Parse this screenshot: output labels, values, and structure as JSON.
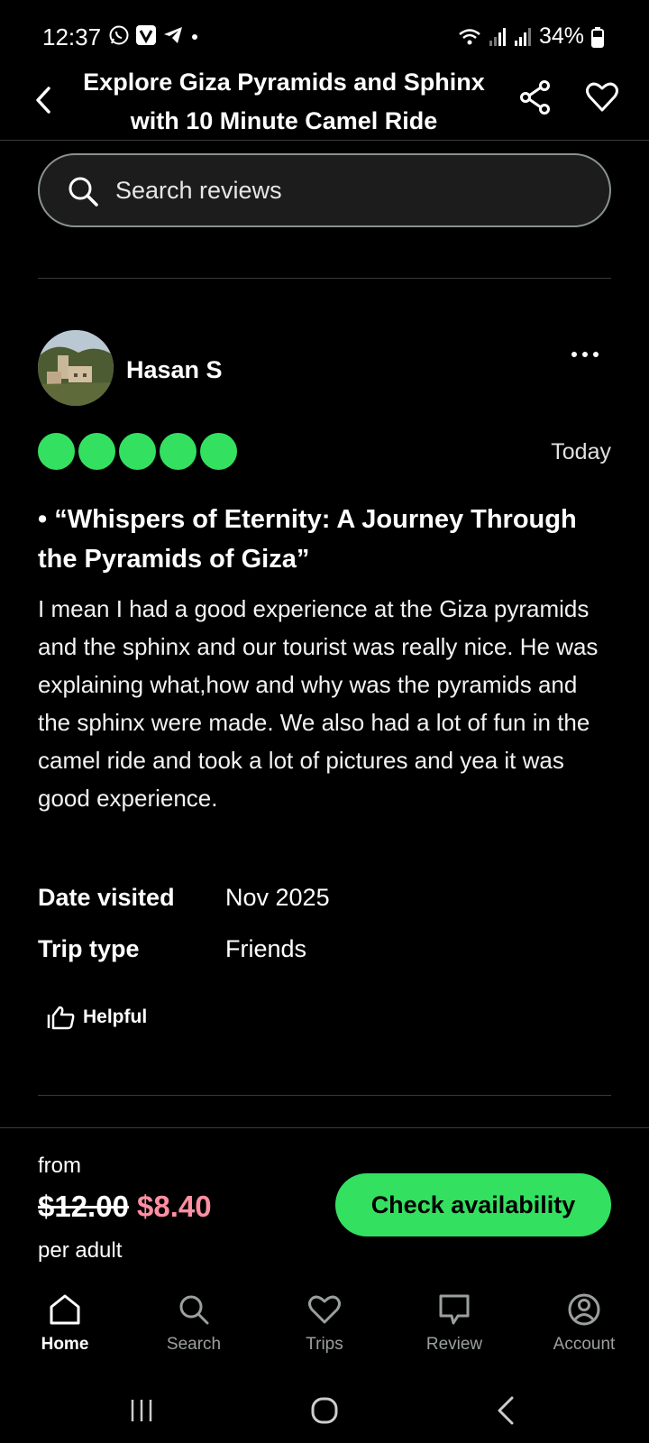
{
  "status_bar": {
    "time": "12:37",
    "battery": "34%"
  },
  "header": {
    "title": "Explore Giza Pyramids and Sphinx with 10 Minute Camel Ride"
  },
  "search": {
    "placeholder": "Search reviews"
  },
  "review": {
    "reviewer": "Hasan S",
    "rating": 5,
    "date": "Today",
    "title": "• “Whispers of Eternity: A Journey Through the Pyramids of Giza”",
    "body": "I mean I had a good experience at the Giza pyramids and the sphinx and our tourist was really nice. He was explaining what,how and why was the pyramids and the sphinx were made. We also had a lot of fun in the camel ride and took a lot of pictures and yea it was good experience.",
    "date_visited_label": "Date visited",
    "date_visited": "Nov 2025",
    "trip_type_label": "Trip type",
    "trip_type": "Friends",
    "helpful_label": "Helpful"
  },
  "booking": {
    "from_label": "from",
    "original_price": "$12.00",
    "price": "$8.40",
    "per_label": "per adult",
    "cta_label": "Check availability"
  },
  "bottom_nav": [
    {
      "label": "Home",
      "icon": "home-icon",
      "active": true
    },
    {
      "label": "Search",
      "icon": "search-icon",
      "active": false
    },
    {
      "label": "Trips",
      "icon": "heart-icon",
      "active": false
    },
    {
      "label": "Review",
      "icon": "review-icon",
      "active": false
    },
    {
      "label": "Account",
      "icon": "account-icon",
      "active": false
    }
  ],
  "colors": {
    "accent": "#34e060",
    "sale_price": "#ff8fa2",
    "background": "#000000"
  }
}
